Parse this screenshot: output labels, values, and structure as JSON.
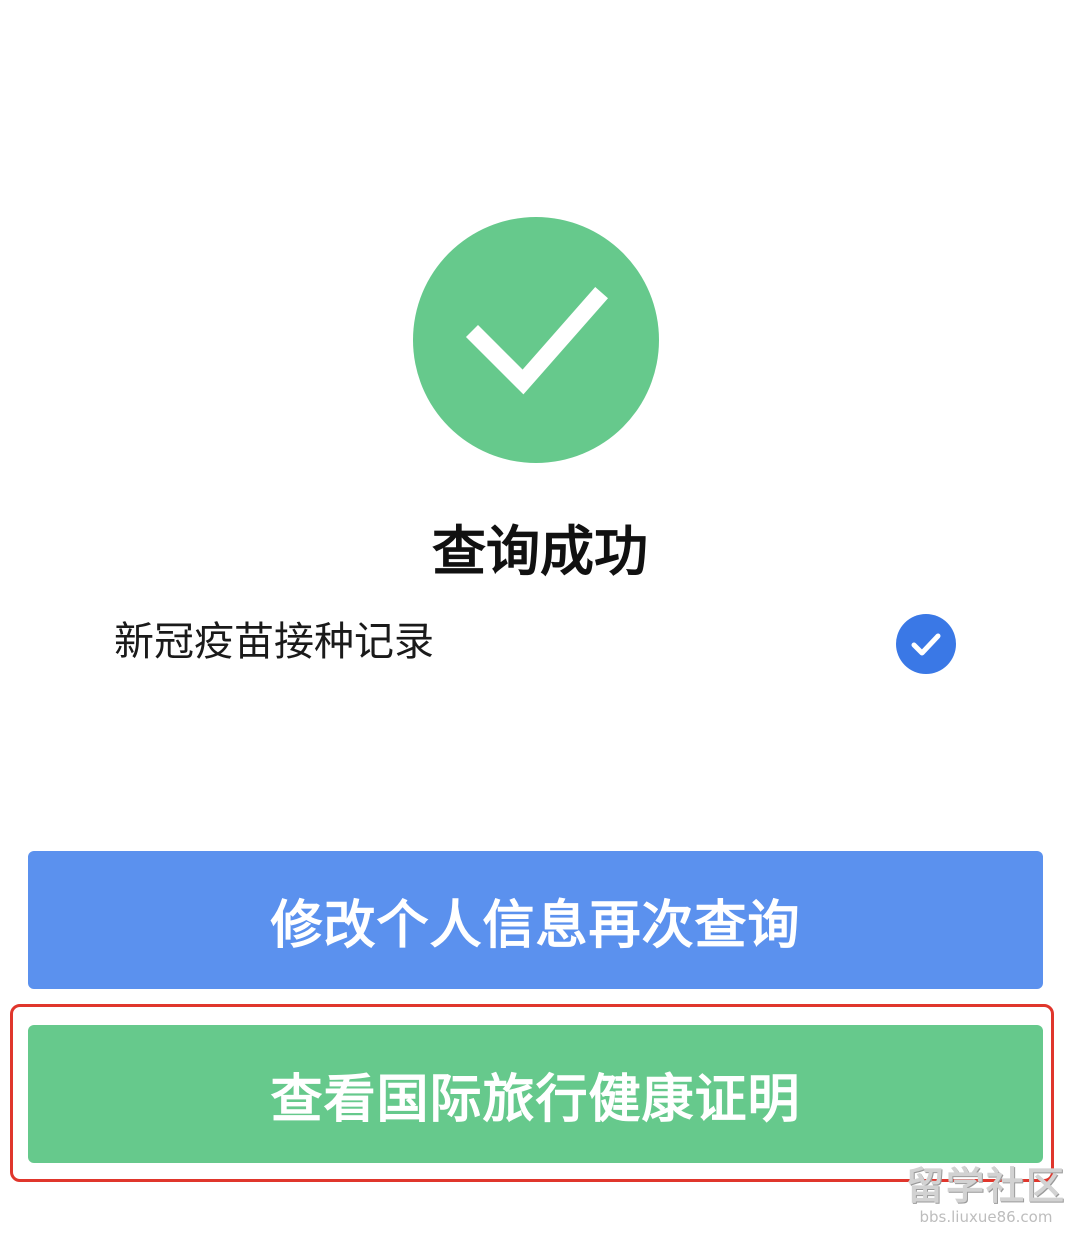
{
  "result": {
    "title": "查询成功",
    "success_icon": "check-circle-icon",
    "success_color": "#66c98c"
  },
  "record": {
    "label": "新冠疫苗接种记录",
    "status_icon": "checkmark-badge-icon",
    "status_color": "#3a78e6"
  },
  "buttons": {
    "modify_label": "修改个人信息再次查询",
    "modify_color": "#5b91ee",
    "view_label": "查看国际旅行健康证明",
    "view_color": "#66c98c"
  },
  "highlight": {
    "color": "#e0362c"
  },
  "watermark": {
    "main": "留学社区",
    "sub": "bbs.liuxue86.com"
  }
}
